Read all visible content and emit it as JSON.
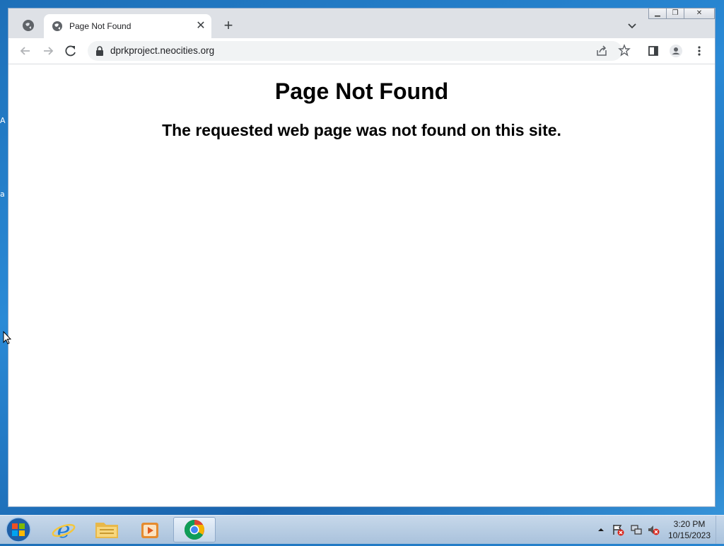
{
  "desktop": {
    "frag1": "A",
    "frag2": "a"
  },
  "browser": {
    "tab": {
      "title": "Page Not Found"
    },
    "omnibox": {
      "url": "dprkproject.neocities.org"
    }
  },
  "page": {
    "heading": "Page Not Found",
    "message": "The requested web page was not found on this site."
  },
  "taskbar": {
    "apps": [
      "start-orb",
      "internet-explorer",
      "file-explorer",
      "media-player",
      "google-chrome"
    ],
    "clock": {
      "time": "3:20 PM",
      "date": "10/15/2023"
    }
  },
  "colors": {
    "tabstrip": "#dee1e6",
    "omnibox": "#f1f3f4",
    "taskbar": "#b7cde3"
  }
}
